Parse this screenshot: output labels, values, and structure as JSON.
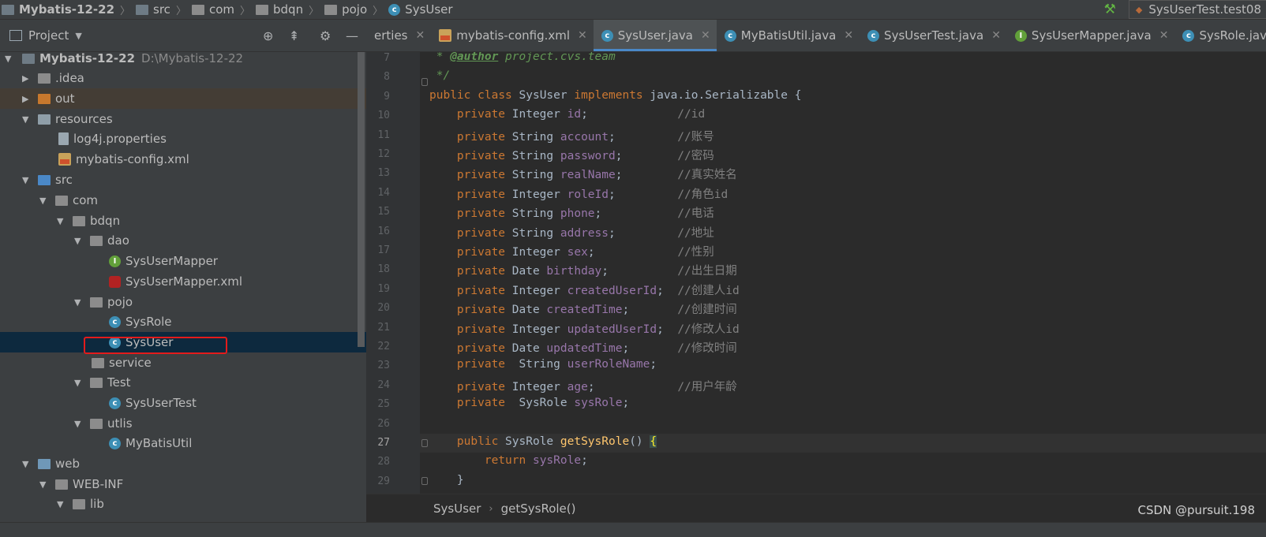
{
  "breadcrumb": [
    "Mybatis-12-22",
    "src",
    "com",
    "bdqn",
    "pojo",
    "SysUser"
  ],
  "run_config": "SysUserTest.test08",
  "project_panel": {
    "title": "Project"
  },
  "tabs": [
    {
      "label": "erties",
      "icon": "properties-icon",
      "active": false
    },
    {
      "label": "mybatis-config.xml",
      "icon": "xml-file-icon",
      "active": false
    },
    {
      "label": "SysUser.java",
      "icon": "class-icon",
      "active": true
    },
    {
      "label": "MyBatisUtil.java",
      "icon": "class-icon",
      "active": false
    },
    {
      "label": "SysUserTest.java",
      "icon": "class-icon",
      "active": false
    },
    {
      "label": "SysUserMapper.java",
      "icon": "interface-icon",
      "active": false
    },
    {
      "label": "SysRole.java",
      "icon": "class-icon",
      "active": false
    }
  ],
  "tree": [
    {
      "label": "Mybatis-12-22",
      "path": "D:\\Mybatis-12-22",
      "icon": "module-folder-icon",
      "expanded": true
    },
    {
      "label": ".idea",
      "icon": "folder-icon",
      "expanded": false
    },
    {
      "label": "out",
      "icon": "excluded-folder-icon",
      "expanded": false
    },
    {
      "label": "resources",
      "icon": "resources-folder-icon",
      "expanded": true
    },
    {
      "label": "log4j.properties",
      "icon": "properties-file-icon"
    },
    {
      "label": "mybatis-config.xml",
      "icon": "xml-file-icon"
    },
    {
      "label": "src",
      "icon": "source-folder-icon",
      "expanded": true
    },
    {
      "label": "com",
      "icon": "package-icon",
      "expanded": true
    },
    {
      "label": "bdqn",
      "icon": "package-icon",
      "expanded": true
    },
    {
      "label": "dao",
      "icon": "package-icon",
      "expanded": true
    },
    {
      "label": "SysUserMapper",
      "icon": "interface-icon"
    },
    {
      "label": "SysUserMapper.xml",
      "icon": "mybatis-xml-icon"
    },
    {
      "label": "pojo",
      "icon": "package-icon",
      "expanded": true
    },
    {
      "label": "SysRole",
      "icon": "class-icon"
    },
    {
      "label": "SysUser",
      "icon": "class-icon",
      "selected": true
    },
    {
      "label": "service",
      "icon": "package-icon"
    },
    {
      "label": "Test",
      "icon": "package-icon",
      "expanded": true
    },
    {
      "label": "SysUserTest",
      "icon": "class-icon"
    },
    {
      "label": "utlis",
      "icon": "package-icon",
      "expanded": true
    },
    {
      "label": "MyBatisUtil",
      "icon": "class-icon"
    },
    {
      "label": "web",
      "icon": "web-folder-icon",
      "expanded": true
    },
    {
      "label": "WEB-INF",
      "icon": "folder-icon",
      "expanded": true
    },
    {
      "label": "lib",
      "icon": "folder-icon",
      "expanded": true
    }
  ],
  "code": [
    {
      "n": "7",
      "text": " * @author project.cvs.team"
    },
    {
      "n": "8",
      "text": " */"
    },
    {
      "n": "9",
      "text": "public class SysUser implements java.io.Serializable {"
    },
    {
      "n": "10",
      "text": "    private Integer id;             //id"
    },
    {
      "n": "11",
      "text": "    private String account;         //账号"
    },
    {
      "n": "12",
      "text": "    private String password;        //密码"
    },
    {
      "n": "13",
      "text": "    private String realName;        //真实姓名"
    },
    {
      "n": "14",
      "text": "    private Integer roleId;         //角色id"
    },
    {
      "n": "15",
      "text": "    private String phone;           //电话"
    },
    {
      "n": "16",
      "text": "    private String address;         //地址"
    },
    {
      "n": "17",
      "text": "    private Integer sex;            //性别"
    },
    {
      "n": "18",
      "text": "    private Date birthday;          //出生日期"
    },
    {
      "n": "19",
      "text": "    private Integer createdUserId;  //创建人id"
    },
    {
      "n": "20",
      "text": "    private Date createdTime;       //创建时间"
    },
    {
      "n": "21",
      "text": "    private Integer updatedUserId;  //修改人id"
    },
    {
      "n": "22",
      "text": "    private Date updatedTime;       //修改时间"
    },
    {
      "n": "23",
      "text": "    private  String userRoleName;"
    },
    {
      "n": "24",
      "text": "    private Integer age;            //用户年龄"
    },
    {
      "n": "25",
      "text": "    private  SysRole sysRole;"
    },
    {
      "n": "26",
      "text": ""
    },
    {
      "n": "27",
      "text": "    public SysRole getSysRole() {"
    },
    {
      "n": "28",
      "text": "        return sysRole;"
    },
    {
      "n": "29",
      "text": "    }"
    }
  ],
  "current_line": "27",
  "editor_breadcrumb": [
    "SysUser",
    "getSysRole()"
  ],
  "watermark": "CSDN @pursuit.198",
  "colors": {
    "keyword": "#cc7832",
    "field": "#9876aa",
    "comment": "#808080",
    "doc": "#629755",
    "method": "#ffc66d",
    "selection": "#0d293e",
    "highlight_box": "#e31b1b"
  }
}
